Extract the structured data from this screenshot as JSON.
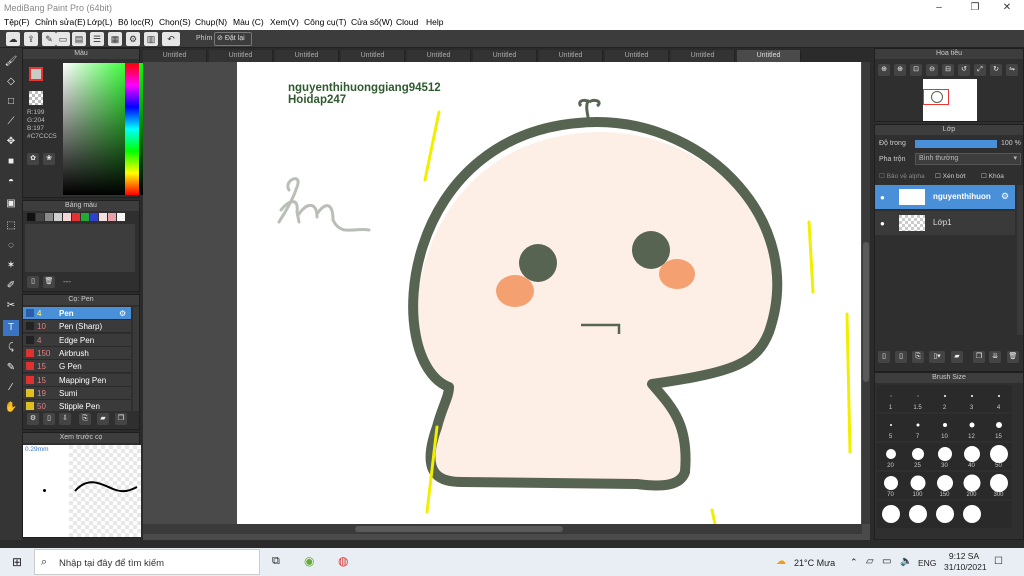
{
  "window": {
    "title": "MediBang Paint Pro (64bit)",
    "controls": [
      "–",
      "❐",
      "✕"
    ]
  },
  "menu": [
    "Tệp(F)",
    "Chỉnh sửa(E)",
    "Lớp(L)",
    "Bộ lọc(R)",
    "Chọn(S)",
    "Chụp(N)",
    "Màu (C)",
    "Xem(V)",
    "Công cụ(T)",
    "Cửa sổ(W)",
    "Cloud",
    "Help"
  ],
  "toolbar": {
    "key_label": "Phím",
    "reset_label": "Đặt lại"
  },
  "color_panel": {
    "title": "Màu",
    "r": "R:199",
    "g": "G:204",
    "b": "B:197",
    "hex": "#C7CCC5"
  },
  "palette_panel": {
    "title": "Bảng màu",
    "swatches": [
      "#111111",
      "#444444",
      "#8a8a8a",
      "#cfcfcf",
      "#f4d6d6",
      "#e33232",
      "#22aa33",
      "#2f3fcf",
      "#f0e0e0",
      "#e8a0a8",
      "#f6f6f6"
    ],
    "more": "---"
  },
  "brush_panel": {
    "title": "Cọ: Pen",
    "items": [
      {
        "size": "4",
        "name": "Pen",
        "color": "#2b5ea8",
        "selected": true
      },
      {
        "size": "10",
        "name": "Pen (Sharp)",
        "color": "#222222",
        "selected": false
      },
      {
        "size": "4",
        "name": "Edge Pen",
        "color": "#222222",
        "selected": false
      },
      {
        "size": "150",
        "name": "Airbrush",
        "color": "#e03030",
        "selected": false
      },
      {
        "size": "15",
        "name": "G Pen",
        "color": "#e03030",
        "selected": false
      },
      {
        "size": "15",
        "name": "Mapping Pen",
        "color": "#e03030",
        "selected": false
      },
      {
        "size": "19",
        "name": "Sumi",
        "color": "#e0c020",
        "selected": false
      },
      {
        "size": "50",
        "name": "Stipple Pen",
        "color": "#e0c020",
        "selected": false
      }
    ]
  },
  "preview_panel": {
    "title": "Xem trước cọ",
    "size": "0.29mm"
  },
  "tabs": [
    "Untitled",
    "Untitled",
    "Untitled",
    "Untitled",
    "Untitled",
    "Untitled",
    "Untitled",
    "Untitled",
    "Untitled",
    "Untitled"
  ],
  "canvas": {
    "text_line1": "nguyenthihuonggiang94512",
    "text_line2": "Hoidap247",
    "doodle": "hm"
  },
  "navigator": {
    "title": "Hoa tiêu"
  },
  "layers_panel": {
    "title": "Lớp",
    "opacity_label": "Độ trong",
    "opacity_value": "100 %",
    "blend_label": "Pha trộn",
    "blend_value": "Bình thường",
    "protect_alpha": "Bảo vệ alpha",
    "clip": "Xén bớt",
    "lock": "Khóa",
    "layers": [
      {
        "name": "nguyenthihuon",
        "selected": true
      },
      {
        "name": "Lớp1",
        "selected": false
      }
    ]
  },
  "brush_size_panel": {
    "title": "Brush Size",
    "sizes": [
      "1",
      "1.5",
      "2",
      "3",
      "4",
      "5",
      "7",
      "10",
      "12",
      "15",
      "20",
      "25",
      "30",
      "40",
      "50",
      "70",
      "100",
      "150",
      "200",
      "300"
    ]
  },
  "taskbar": {
    "search_placeholder": "Nhập tại đây để tìm kiếm",
    "weather": "21°C  Mưa",
    "lang": "ENG",
    "time": "9:12 SA",
    "date": "31/10/2021"
  }
}
